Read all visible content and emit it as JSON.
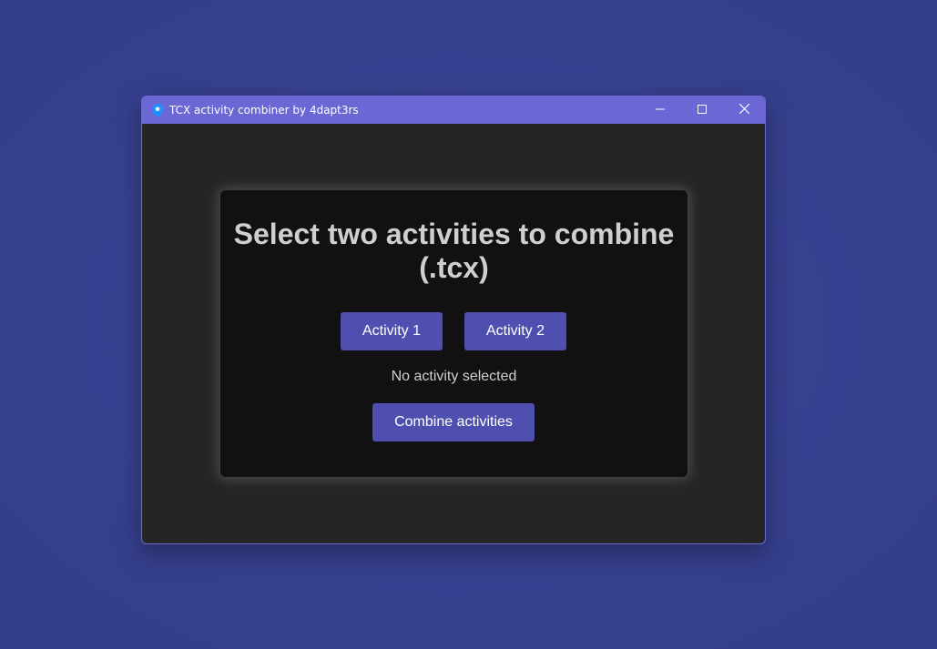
{
  "window": {
    "title": "TCX activity combiner by 4dapt3rs",
    "icon": "map-pin-icon",
    "controls": [
      "minimize-icon",
      "maximize-icon",
      "close-icon"
    ]
  },
  "card": {
    "title": "Select two activities to combine (.tcx)",
    "activity1_label": "Activity 1",
    "activity2_label": "Activity 2",
    "status": "No activity selected",
    "combine_label": "Combine activities"
  },
  "colors": {
    "desktop": "#37408f",
    "titlebar": "#6b68d6",
    "window_bg": "#252525",
    "card_bg": "#111111",
    "button": "#4f4fb0",
    "title_text": "#cfcfcf"
  }
}
